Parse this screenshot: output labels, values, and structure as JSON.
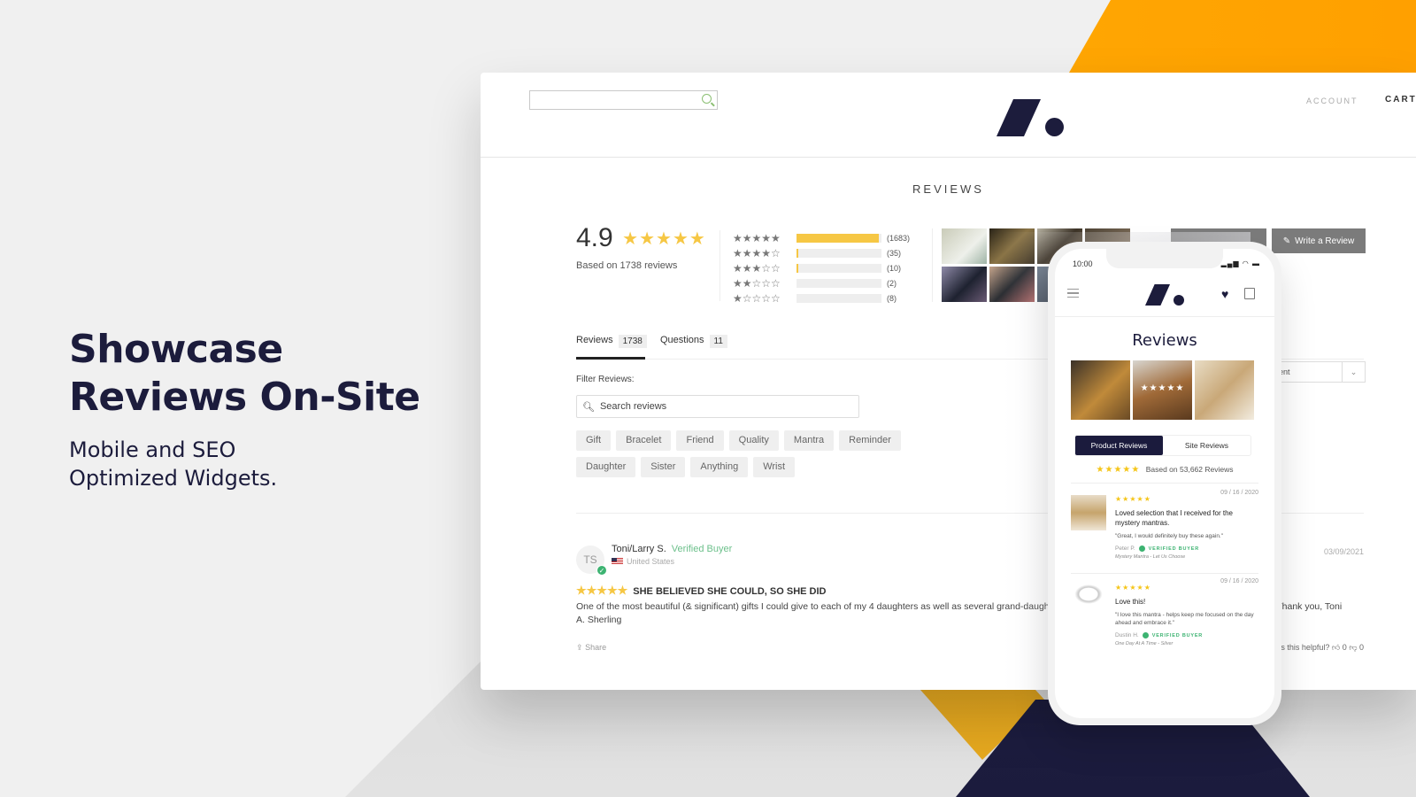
{
  "hero": {
    "headline_line1": "Showcase",
    "headline_line2": "Reviews On-Site",
    "subhead_line1": "Mobile and SEO",
    "subhead_line2": "Optimized Widgets."
  },
  "colors": {
    "brand_navy": "#1c1c3c",
    "accent_yellow": "#ffb000",
    "star_yellow": "#f6c744",
    "verified_green": "#3cb371"
  },
  "store": {
    "search_placeholder": "",
    "nav": {
      "account": "ACCOUNT",
      "cart": "CART"
    },
    "logo_icon": "brand-slash-dot-logo"
  },
  "reviews_widget": {
    "title": "REVIEWS",
    "average_rating": "4.9",
    "average_stars": "★★★★★",
    "based_on": "Based on 1738 reviews",
    "histogram": [
      {
        "stars": "★★★★★",
        "count": "(1683)",
        "share": 0.97
      },
      {
        "stars": "★★★★☆",
        "count": "(35)",
        "share": 0.02
      },
      {
        "stars": "★★★☆☆",
        "count": "(10)",
        "share": 0.01
      },
      {
        "stars": "★★☆☆☆",
        "count": "(2)",
        "share": 0.0
      },
      {
        "stars": "★☆☆☆☆",
        "count": "(8)",
        "share": 0.0
      }
    ],
    "write_review_label": "Write a Review",
    "tabs": [
      {
        "label": "Reviews",
        "count": "1738",
        "active": true
      },
      {
        "label": "Questions",
        "count": "11",
        "active": false
      }
    ],
    "filter_label": "Filter Reviews:",
    "filter_search_placeholder": "Search reviews",
    "filter_chips": [
      "Gift",
      "Bracelet",
      "Friend",
      "Quality",
      "Mantra",
      "Reminder",
      "Daughter",
      "Sister",
      "Anything",
      "Wrist"
    ],
    "sort": {
      "selected": "Recent"
    },
    "review": {
      "initials": "TS",
      "name": "Toni/Larry S.",
      "verified_label": "Verified Buyer",
      "location": "United States",
      "date": "03/09/2021",
      "stars": "★★★★★",
      "title": "SHE BELIEVED SHE COULD, SO SHE DID",
      "body": "One of the most beautiful (& significant) gifts I could give to each of my 4 daughters as well as several grand-daughters for their graduations. Each recipient LOVED them. Thank you, Toni A. Sherling",
      "share_label": "Share",
      "helpful_label": "Was this helpful?",
      "thumbs_up": "0",
      "thumbs_down": "0"
    }
  },
  "mobile": {
    "time": "10:00",
    "status_icons": "▂▄▆ ◠ ▬",
    "title": "Reviews",
    "photo_overlay_stars": "★★★★★",
    "toggle": {
      "product": "Product Reviews",
      "site": "Site Reviews"
    },
    "based_stars": "★★★★★",
    "based_on": "Based on 53,662 Reviews",
    "reviews": [
      {
        "stars": "★★★★★",
        "date": "09 / 16 / 2020",
        "title": "Loved selection that I received for the mystery mantras.",
        "quote": "\"Great, I would definitely buy these again.\"",
        "author": "Peter P.",
        "verified": "VERIFIED BUYER",
        "product": "Mystery Mantra - Let Us Choose"
      },
      {
        "stars": "★★★★★",
        "date": "09 / 16 / 2020",
        "title": "Love this!",
        "quote": "\"I love this mantra - helps keep me focused on the day ahead and embrace it.\"",
        "author": "Dustin H.",
        "verified": "VERIFIED BUYER",
        "product": "One Day At A Time - Silver"
      }
    ]
  }
}
